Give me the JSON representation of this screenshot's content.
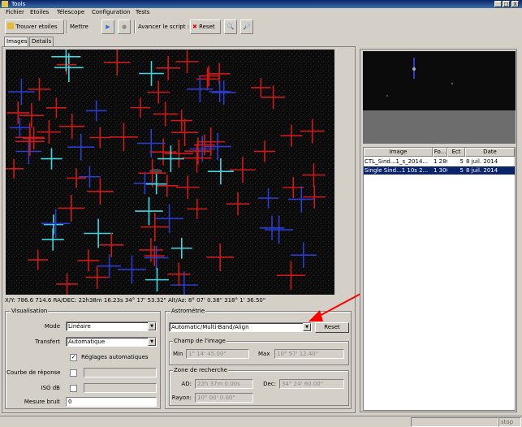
{
  "window": {
    "title": "Tools",
    "min": "_",
    "max": "□",
    "close": "X"
  },
  "menu": [
    "Fichier",
    "Etoiles",
    "Télescope",
    "Configuration",
    "Tests"
  ],
  "toolbar": {
    "find_stars": "Trouver etoiles",
    "mettre": "Mettre",
    "avancer_label": "Avancer le script :",
    "reset": "Reset"
  },
  "tabs": [
    "Images",
    "Details"
  ],
  "image_status": "X/Y: 786.6 714.6   RA/DEC: 22h38m 16.23s 34° 17' 53.32\"  Alt/Az: 8° 07' 0.38\" 318° 1' 36.50\"",
  "visualisation": {
    "legend": "Visualisation",
    "mode_label": "Mode",
    "mode_value": "Linéaire",
    "transfert_label": "Transfert",
    "transfert_value": "Automatique",
    "reglage_label": "Réglages automatiques",
    "courbe_label": "Courbe de réponse",
    "iso_label": "ISO dB",
    "mesure_label": "Mesure bruit",
    "mesure_value": "0"
  },
  "astrometrie": {
    "legend": "Astrométrie",
    "method_value": "Automatic/Multi-Band/Align",
    "reset": "Reset",
    "champ_legend": "Champ de l'image",
    "min_label": "Min",
    "min_value": "1° 14' 45.00\"",
    "max_label": "Max",
    "max_value": "10° 57' 12.40\"",
    "zone_legend": "Zone de recherche",
    "ad_label": "AD:",
    "ad_value": "22h 37m 0.00s",
    "dec_label": "Dec:",
    "dec_value": "34° 24' 60.00\"",
    "rayon_label": "Rayon:",
    "rayon_value": "10° 00' 0.00\""
  },
  "file_table": {
    "headers": [
      "Image",
      "Fo...",
      "Ect",
      "Date"
    ],
    "rows": [
      {
        "image": "CTL_Sind...1_s_2014...",
        "fo": "1 280",
        "ect": "5",
        "date": "8 juil. 2014",
        "selected": false
      },
      {
        "image": "Single Sind...1 10s 2...",
        "fo": "1 300",
        "ect": "5",
        "date": "8 juil. 2014",
        "selected": true
      }
    ]
  },
  "status": {
    "right": "stop"
  },
  "colors": {
    "selection": "#0a246a",
    "arrow": "#ff0000",
    "title_bg": "#0a246a"
  }
}
